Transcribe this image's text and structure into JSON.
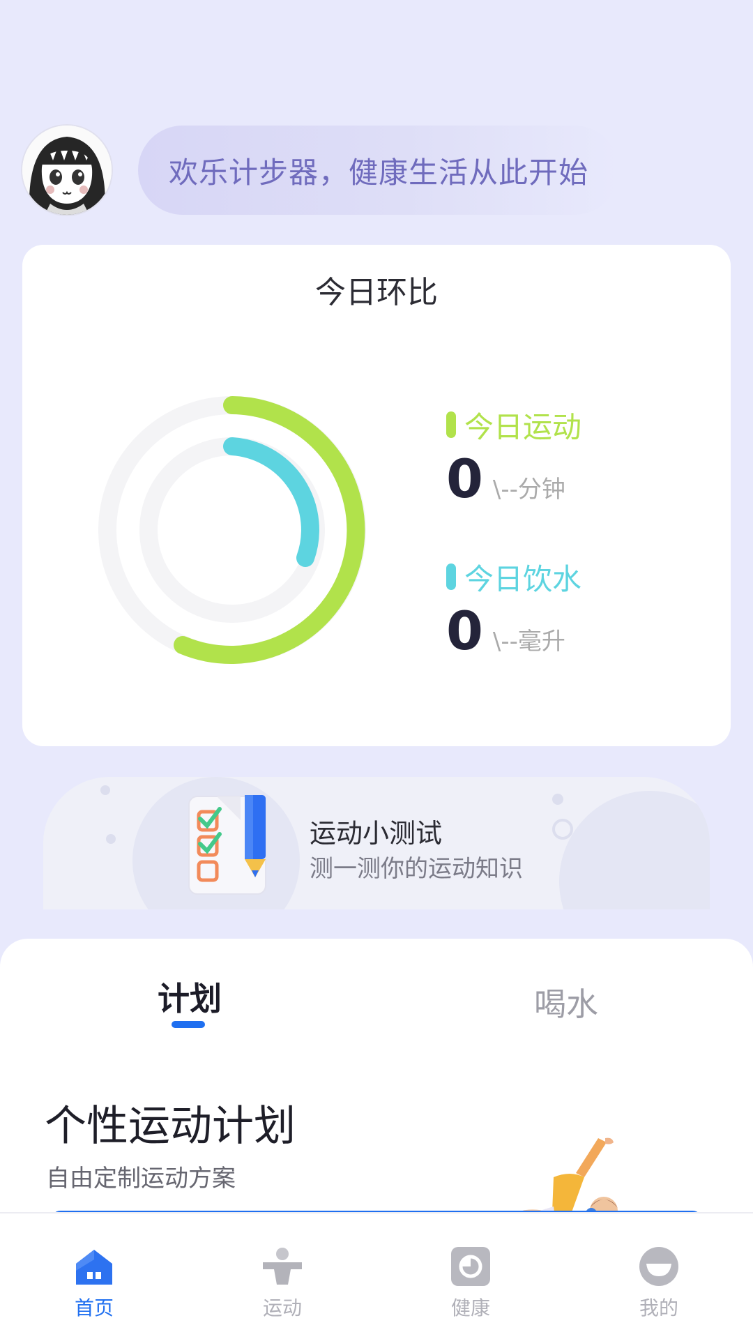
{
  "header": {
    "greeting": "欢乐计步器，健康生活从此开始"
  },
  "ring_card": {
    "title": "今日环比",
    "exercise": {
      "label": "今日运动",
      "value": "0",
      "unit": "\\--分钟",
      "color": "#b1e24b"
    },
    "water": {
      "label": "今日饮水",
      "value": "0",
      "unit": "\\--毫升",
      "color": "#5dd4e0"
    }
  },
  "quiz": {
    "title": "运动小测试",
    "subtitle": "测一测你的运动知识"
  },
  "sheet": {
    "tabs": [
      {
        "label": "计划",
        "active": true
      },
      {
        "label": "喝水",
        "active": false
      }
    ],
    "plan_title": "个性运动计划",
    "plan_subtitle": "自由定制运动方案"
  },
  "tabbar": {
    "items": [
      {
        "label": "首页",
        "icon": "home-icon",
        "active": true
      },
      {
        "label": "运动",
        "icon": "exercise-icon",
        "active": false
      },
      {
        "label": "健康",
        "icon": "health-icon",
        "active": false
      },
      {
        "label": "我的",
        "icon": "profile-icon",
        "active": false
      }
    ],
    "accent_color": "#1f6ff0"
  }
}
